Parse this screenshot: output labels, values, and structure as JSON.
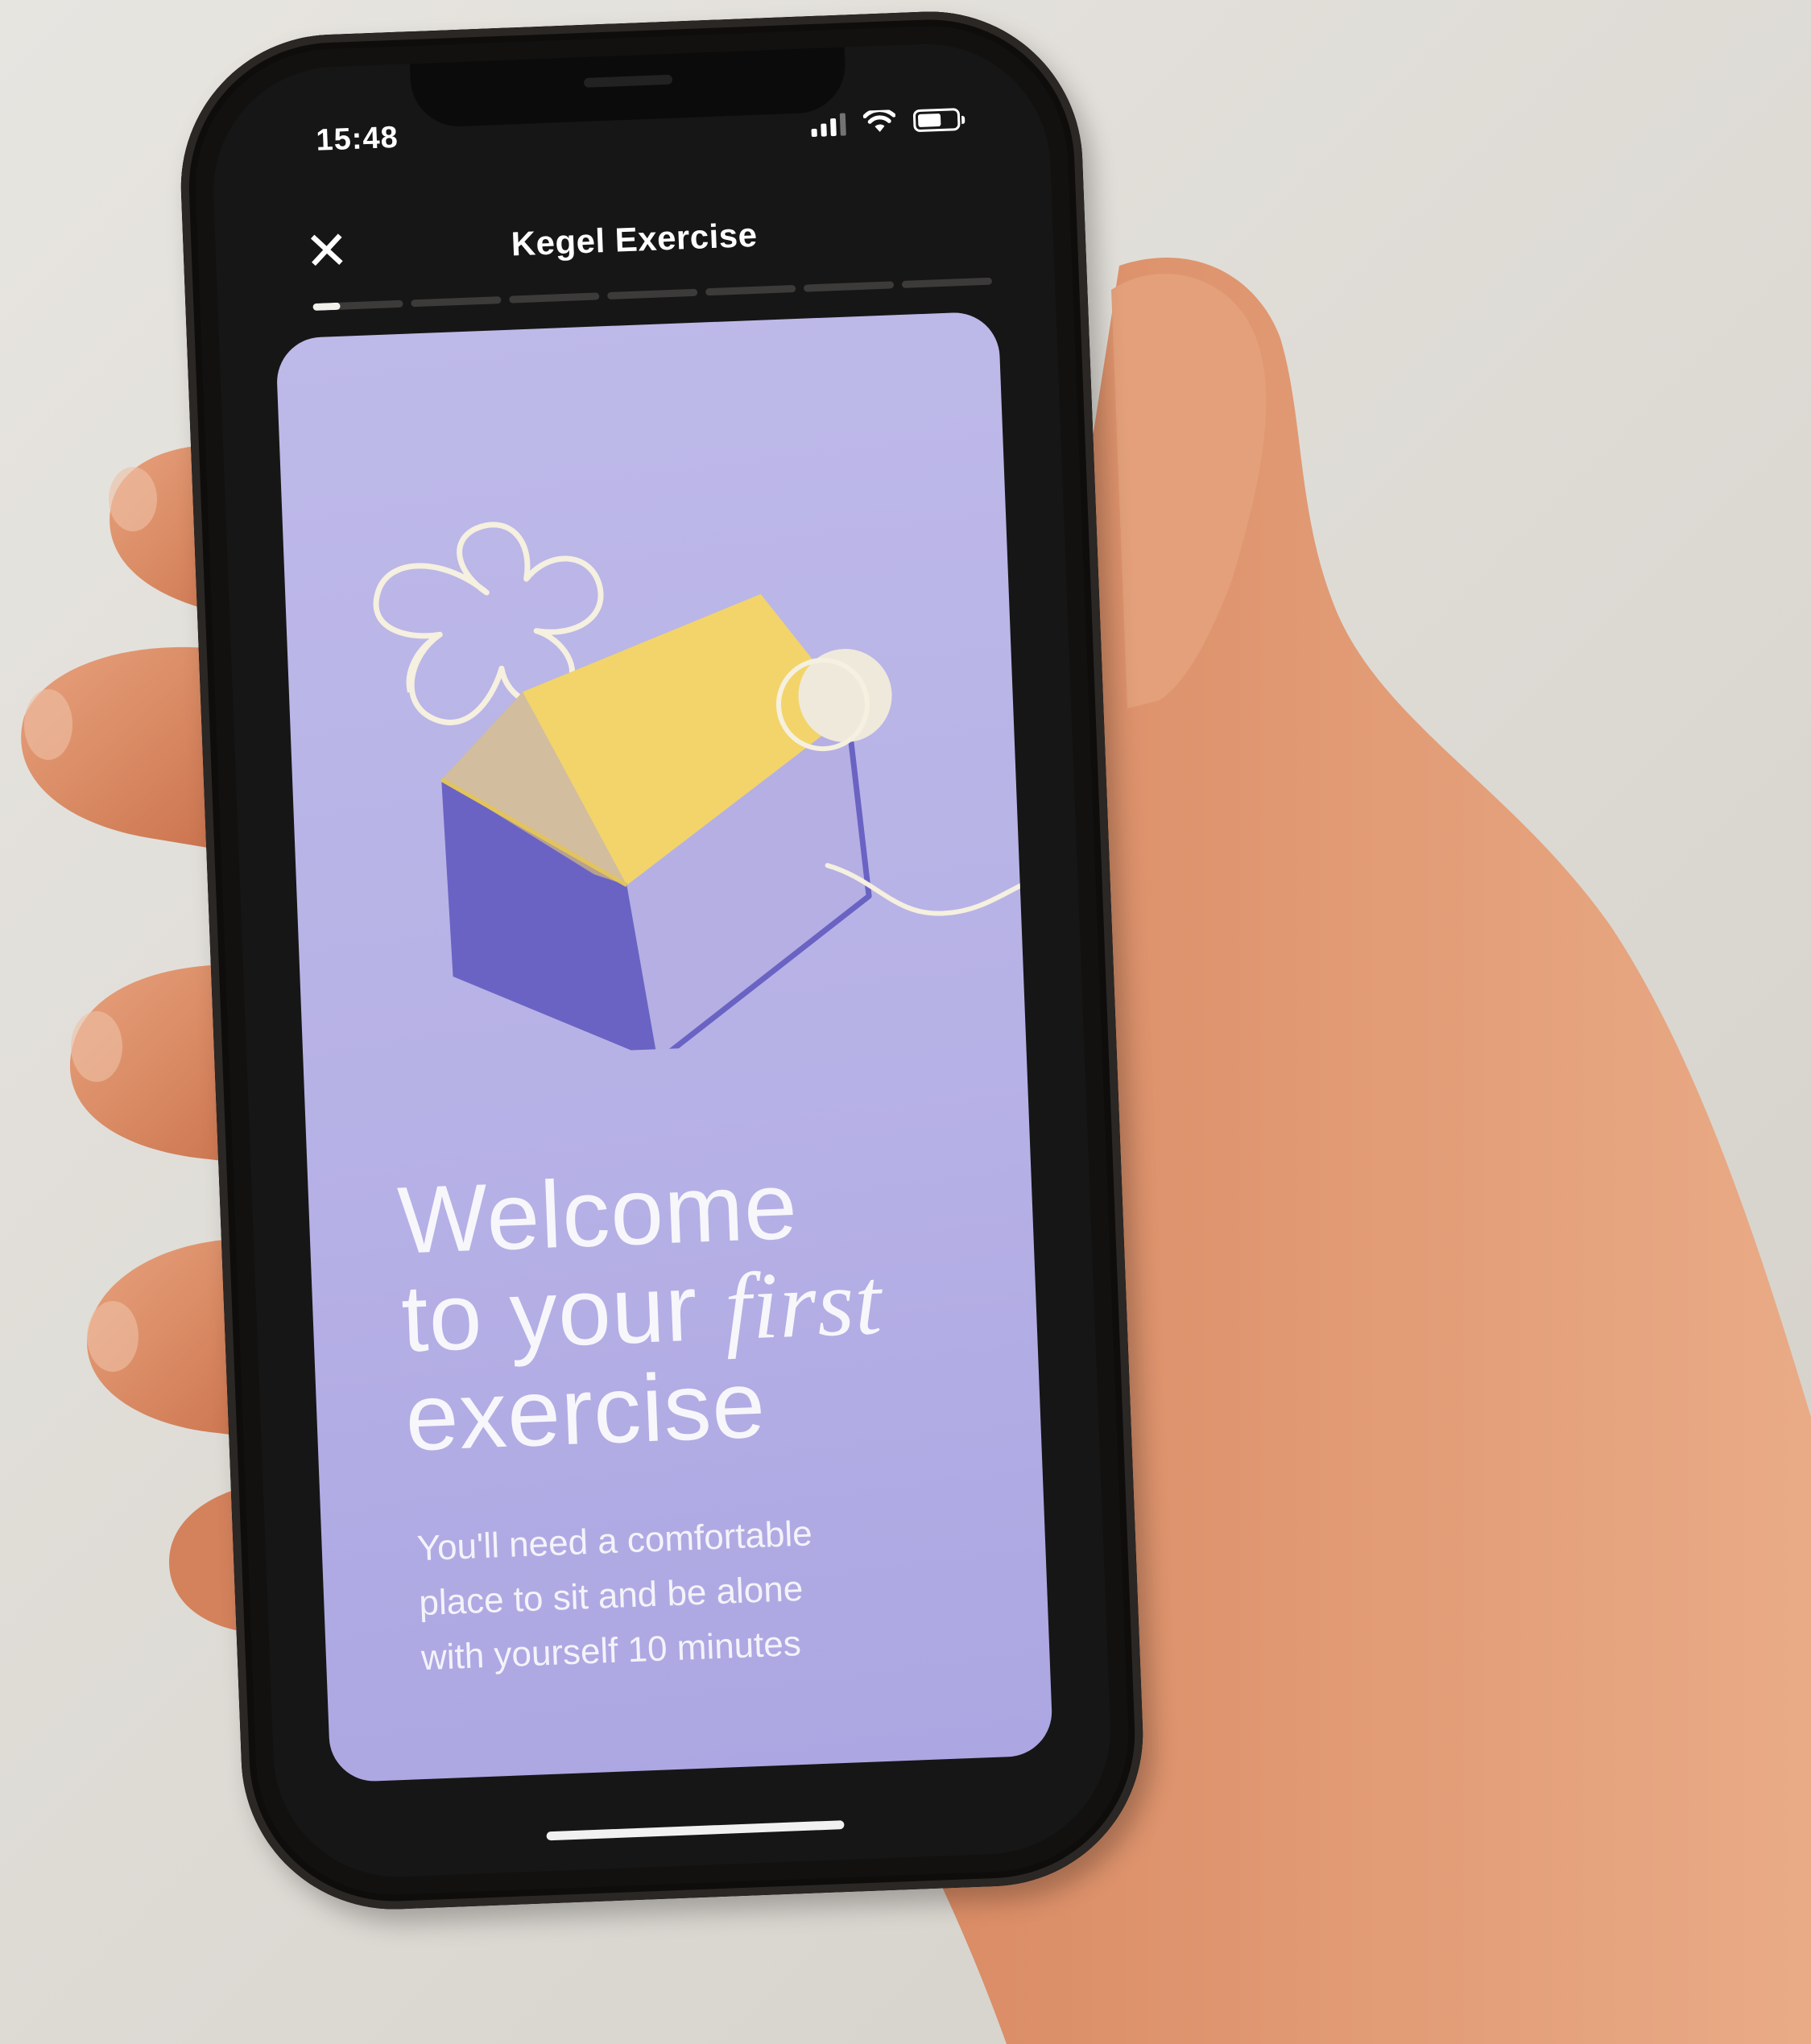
{
  "status_bar": {
    "time": "15:48",
    "signal_icon": "cellular-signal-icon",
    "wifi_icon": "wifi-icon",
    "battery_icon": "battery-icon",
    "battery_level": 0.65
  },
  "header": {
    "close_icon": "close-icon",
    "close_glyph": "✕",
    "title": "Kegel Exercise"
  },
  "progress": {
    "total_steps": 7,
    "current_step": 1,
    "current_step_fraction": 0.3
  },
  "card": {
    "illustration": "house-with-flower-and-moon-illustration",
    "headline": {
      "line1": "Welcome",
      "line2_prefix": "to your ",
      "line2_emphasis": "first",
      "line3": "exercise"
    },
    "body": {
      "line1": "You'll need a comfortable",
      "line2": "place to sit  and be alone",
      "line3": "with yourself 10 minutes"
    }
  },
  "colors": {
    "card_background": "#b7b2e6",
    "roof_yellow": "#f2d46a",
    "wall_dark": "#6a63c4",
    "screen_background": "#161616",
    "text_on_card": "#f7f6fb"
  }
}
